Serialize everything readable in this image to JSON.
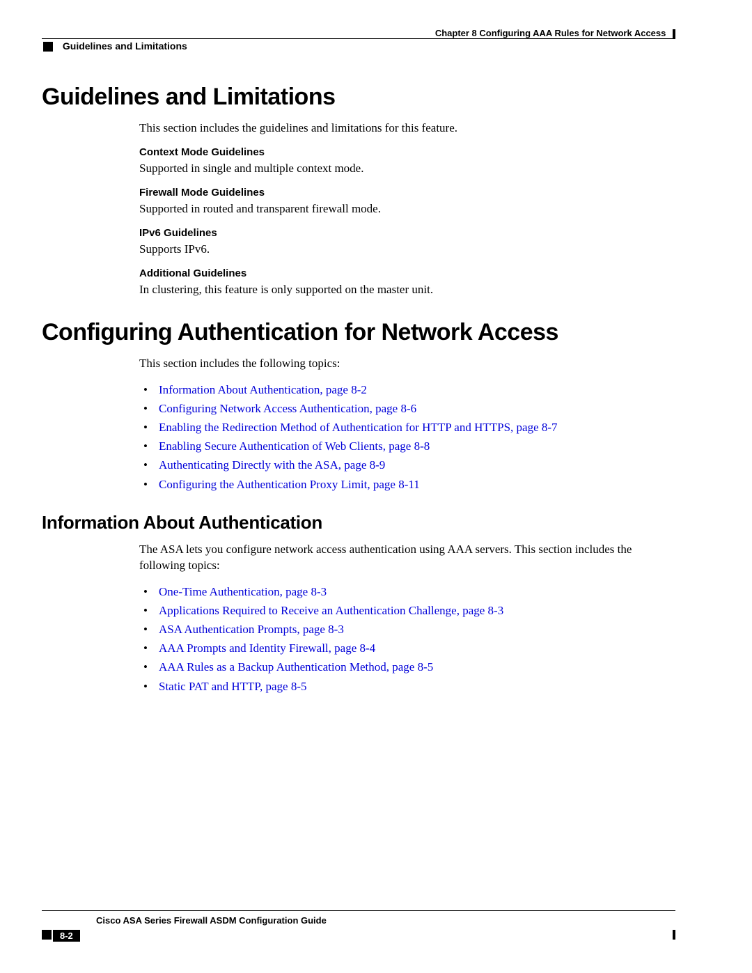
{
  "header": {
    "chapter": "Chapter 8      Configuring AAA Rules for Network Access",
    "section": "Guidelines and Limitations"
  },
  "h1a": "Guidelines and Limitations",
  "intro_a": "This section includes the guidelines and limitations for this feature.",
  "sub1": {
    "title": "Context Mode Guidelines",
    "body": "Supported in single and multiple context mode."
  },
  "sub2": {
    "title": "Firewall Mode Guidelines",
    "body": "Supported in routed and transparent firewall mode."
  },
  "sub3": {
    "title": "IPv6 Guidelines",
    "body": "Supports IPv6."
  },
  "sub4": {
    "title": "Additional Guidelines",
    "body": "In clustering, this feature is only supported on the master unit."
  },
  "h1b": "Configuring Authentication for Network Access",
  "intro_b": "This section includes the following topics:",
  "topics_b": [
    "Information About Authentication, page 8-2",
    "Configuring Network Access Authentication, page 8-6",
    "Enabling the Redirection Method of Authentication for HTTP and HTTPS, page 8-7",
    "Enabling Secure Authentication of Web Clients, page 8-8",
    "Authenticating Directly with the ASA, page 8-9",
    "Configuring the Authentication Proxy Limit, page 8-11"
  ],
  "h2a": "Information About Authentication",
  "intro_c": "The ASA lets you configure network access authentication using AAA servers. This section includes the following topics:",
  "topics_c": [
    "One-Time Authentication, page 8-3",
    "Applications Required to Receive an Authentication Challenge, page 8-3",
    "ASA Authentication Prompts, page 8-3",
    "AAA Prompts and Identity Firewall, page 8-4",
    "AAA Rules as a Backup Authentication Method, page 8-5",
    "Static PAT and HTTP, page 8-5"
  ],
  "footer": {
    "guide": "Cisco ASA Series Firewall ASDM Configuration Guide",
    "page": "8-2"
  }
}
